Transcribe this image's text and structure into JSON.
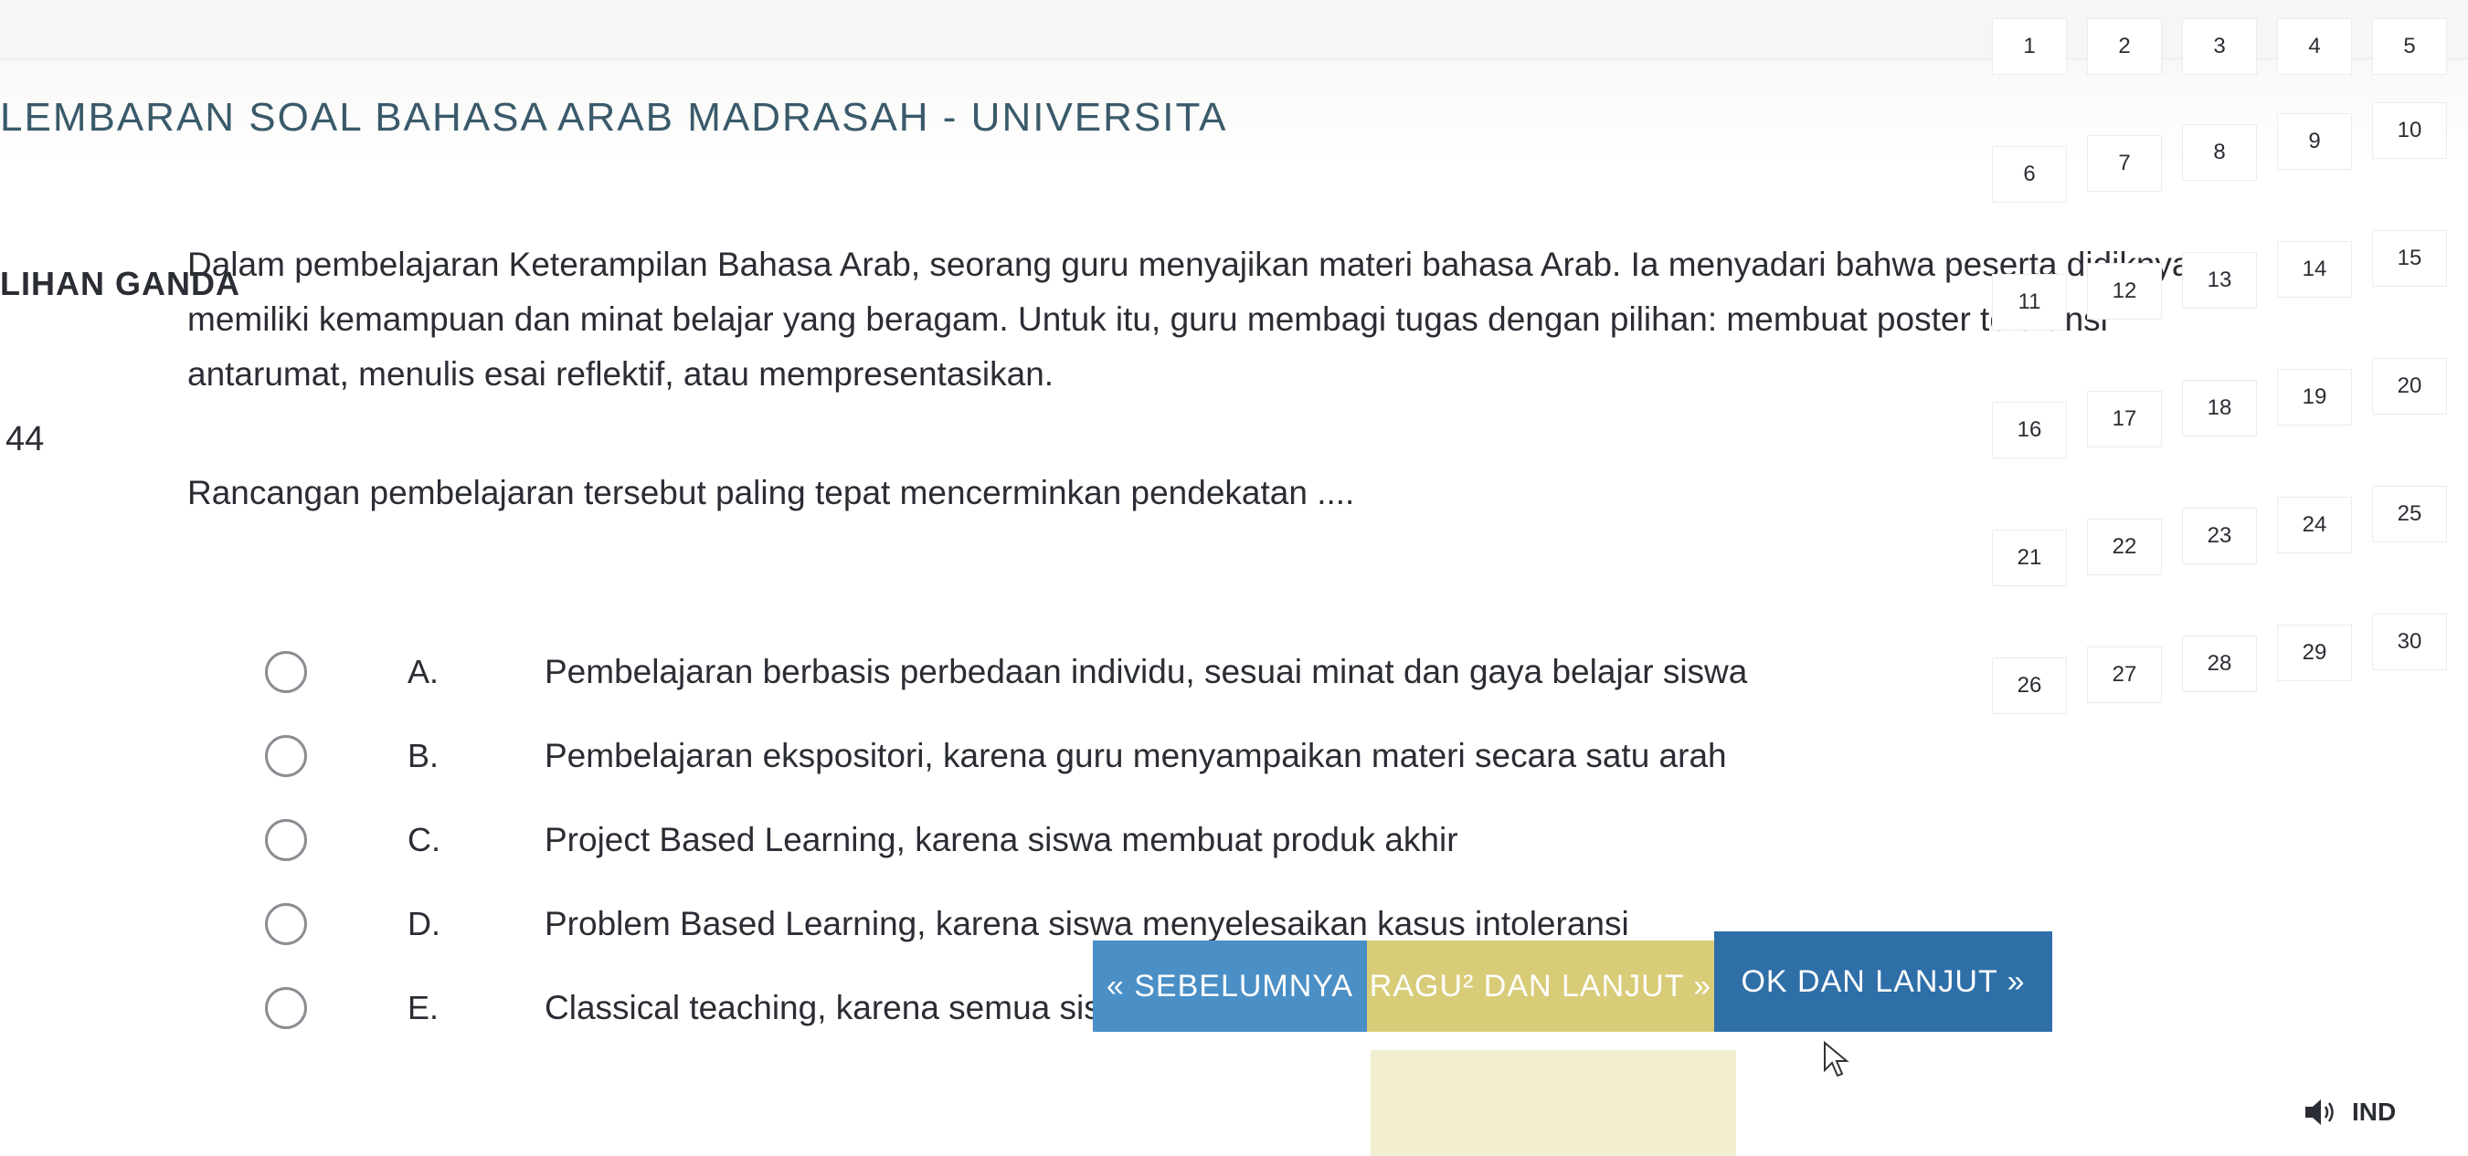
{
  "header": {
    "title": "LEMBARAN SOAL BAHASA ARAB MADRASAH - UNIVERSITA"
  },
  "section": {
    "label": "LIHAN GANDA"
  },
  "question": {
    "number": "44",
    "lines": [
      "Dalam pembelajaran Keterampilan Bahasa Arab, seorang guru menyajikan materi bahasa Arab. Ia menyadari bahwa peserta didiknya",
      "memiliki kemampuan dan minat belajar yang beragam. Untuk itu, guru membagi tugas dengan pilihan: membuat poster toleransi",
      "antarumat, menulis esai reflektif, atau mempresentasikan."
    ],
    "prompt": "Rancangan pembelajaran tersebut paling tepat mencerminkan pendekatan ...."
  },
  "options": [
    {
      "letter": "A.",
      "text": "Pembelajaran berbasis perbedaan individu, sesuai minat dan gaya belajar siswa"
    },
    {
      "letter": "B.",
      "text": "Pembelajaran ekspositori, karena guru menyampaikan materi secara satu arah"
    },
    {
      "letter": "C.",
      "text": "Project Based Learning, karena siswa membuat produk akhir"
    },
    {
      "letter": "D.",
      "text": "Problem Based Learning, karena siswa menyelesaikan kasus intoleransi"
    },
    {
      "letter": "E.",
      "text": "Classical teaching, karena semua siswa diberi tugas yang sama"
    }
  ],
  "nav": {
    "prev_label": "« SEBELUMNYA",
    "doubt_label": "RAGU² DAN LANJUT »",
    "ok_label": "OK DAN LANJUT »"
  },
  "grid": {
    "numbers": [
      "1",
      "2",
      "3",
      "4",
      "5",
      "6",
      "7",
      "8",
      "9",
      "10",
      "11",
      "12",
      "13",
      "14",
      "15",
      "16",
      "17",
      "18",
      "19",
      "20",
      "21",
      "22",
      "23",
      "24",
      "25",
      "26",
      "27",
      "28",
      "29",
      "30"
    ]
  },
  "footer": {
    "language": "IND"
  }
}
